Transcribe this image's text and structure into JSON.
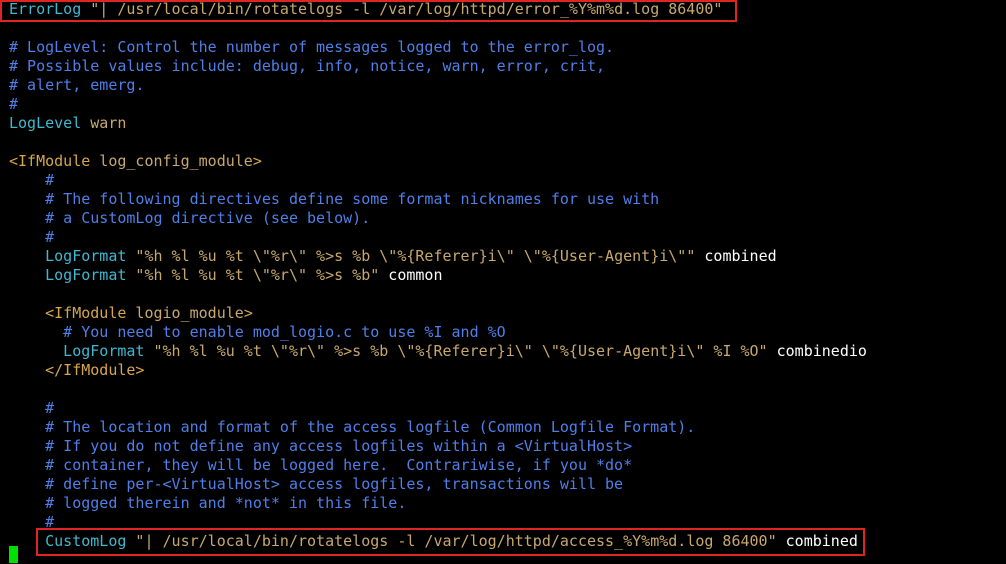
{
  "colors": {
    "background": "#000000",
    "comment": "#4f7fe8",
    "directive": "#3fb8d0",
    "string": "#c8a86c",
    "tag": "#d6a64a",
    "plain": "#ffffff",
    "highlight_border": "#e02424",
    "cursor": "#00e000"
  },
  "editor": {
    "lines": [
      [
        {
          "t": "ErrorLog",
          "c": "directive"
        },
        {
          "t": " \"| /usr/local/bin/rotatelogs -l /var/log/httpd/error_%Y%m%d.log 86400\"",
          "c": "string"
        }
      ],
      [],
      [
        {
          "t": "# LogLevel: Control the number of messages logged to the error_log.",
          "c": "comment"
        }
      ],
      [
        {
          "t": "# Possible values include: debug, info, notice, warn, error, crit,",
          "c": "comment"
        }
      ],
      [
        {
          "t": "# alert, emerg.",
          "c": "comment"
        }
      ],
      [
        {
          "t": "#",
          "c": "comment"
        }
      ],
      [
        {
          "t": "LogLevel",
          "c": "directive"
        },
        {
          "t": " warn",
          "c": "string"
        }
      ],
      [],
      [
        {
          "t": "<IfModule",
          "c": "tag"
        },
        {
          "t": " log_config_module",
          "c": "string"
        },
        {
          "t": ">",
          "c": "tag"
        }
      ],
      [
        {
          "t": "    #",
          "c": "comment"
        }
      ],
      [
        {
          "t": "    # The following directives define some format nicknames for use with",
          "c": "comment"
        }
      ],
      [
        {
          "t": "    # a CustomLog directive (see below).",
          "c": "comment"
        }
      ],
      [
        {
          "t": "    #",
          "c": "comment"
        }
      ],
      [
        {
          "t": "    LogFormat",
          "c": "directive"
        },
        {
          "t": " \"%h %l %u %t \\\"%r\\\" %>s %b \\\"%{Referer}i\\\" \\\"%{User-Agent}i\\\"\"",
          "c": "string"
        },
        {
          "t": " combined",
          "c": "plain"
        }
      ],
      [
        {
          "t": "    LogFormat",
          "c": "directive"
        },
        {
          "t": " \"%h %l %u %t \\\"%r\\\" %>s %b\"",
          "c": "string"
        },
        {
          "t": " common",
          "c": "plain"
        }
      ],
      [],
      [
        {
          "t": "    <IfModule",
          "c": "tag"
        },
        {
          "t": " logio_module",
          "c": "string"
        },
        {
          "t": ">",
          "c": "tag"
        }
      ],
      [
        {
          "t": "      # You need to enable mod_logio.c to use %I and %O",
          "c": "comment"
        }
      ],
      [
        {
          "t": "      LogFormat",
          "c": "directive"
        },
        {
          "t": " \"%h %l %u %t \\\"%r\\\" %>s %b \\\"%{Referer}i\\\" \\\"%{User-Agent}i\\\" %I %O\"",
          "c": "string"
        },
        {
          "t": " combinedio",
          "c": "plain"
        }
      ],
      [
        {
          "t": "    </IfModule>",
          "c": "tag"
        }
      ],
      [],
      [
        {
          "t": "    #",
          "c": "comment"
        }
      ],
      [
        {
          "t": "    # The location and format of the access logfile (Common Logfile Format).",
          "c": "comment"
        }
      ],
      [
        {
          "t": "    # If you do not define any access logfiles within a <VirtualHost>",
          "c": "comment"
        }
      ],
      [
        {
          "t": "    # container, they will be logged here.  Contrariwise, if you *do*",
          "c": "comment"
        }
      ],
      [
        {
          "t": "    # define per-<VirtualHost> access logfiles, transactions will be",
          "c": "comment"
        }
      ],
      [
        {
          "t": "    # logged therein and *not* in this file.",
          "c": "comment"
        }
      ],
      [
        {
          "t": "    #",
          "c": "comment"
        }
      ],
      [
        {
          "t": "    CustomLog",
          "c": "directive"
        },
        {
          "t": " \"| /usr/local/bin/rotatelogs -l /var/log/httpd/access_%Y%m%d.log 86400\"",
          "c": "string"
        },
        {
          "t": " combined",
          "c": "plain"
        }
      ]
    ]
  }
}
